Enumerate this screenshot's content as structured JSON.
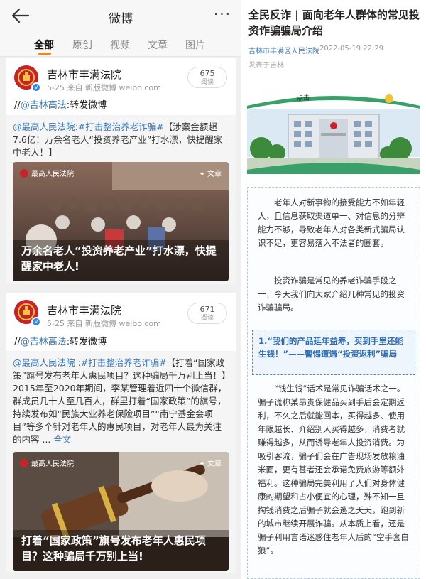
{
  "weibo": {
    "title": "微博",
    "more": "···",
    "tabs": [
      "全部",
      "原创",
      "视频",
      "文章",
      "图片"
    ],
    "posts": [
      {
        "author": "吉林市丰满法院",
        "meta": "5-25  来自 新版微博 weibo.com",
        "reads": "675",
        "reads_label": "阅读",
        "repost_prefix": "//",
        "repost_link": "@吉林高法",
        "repost_suffix": ":转发微博",
        "quote_author": "@最高人民法院",
        "quote_tag": ":#打击整治养老诈骗#",
        "quote_body": "【涉案金额超7.6亿！万余名老人“投资养老产业”打水漂，快提醒家中老人！】",
        "card_source": "最高人民法院",
        "card_tag": "文章",
        "card_caption": "万余名老人“投资养老产业”打水漂，快提醒家中老人!"
      },
      {
        "author": "吉林市丰满法院",
        "meta": "5-25  来自 新版微博 weibo.com",
        "reads": "671",
        "reads_label": "阅读",
        "repost_prefix": "//",
        "repost_link": "@吉林高法",
        "repost_suffix": ":转发微博",
        "quote_author": "@最高人民法院",
        "quote_tag": " :#打击整治养老诈骗#",
        "quote_body": "【打着“国家政策”旗号发布老年人惠民项目？这种骗局千万别上当！】2015年至2020年期间，李某管理着近四十个微信群，群成员几十人至几百人，群里打着“国家政策”的旗号，持续发布如“民族大业养老保险项目”“南宁基金会项目”等多个针对老年人的惠民项目，对老年人最为关注的内容 ... ",
        "quote_more": "全文",
        "card_source": "最高人民法院",
        "card_tag": "文章",
        "card_caption": "打着“国家政策”旗号发布老年人惠民项目？这种骗局千万别上当!"
      }
    ]
  },
  "article": {
    "title": "全民反诈 | 面向老年人群体的常见投资诈骗骗局介绍",
    "org": "吉林市丰满区人民法院",
    "date": "2022-05-19 22:29",
    "from": "发表于吉林",
    "banner_label": "点击",
    "p1": "老年人对新事物的接受能力不如年轻人，且信息获取渠道单一、对信息的分辨能力不够，导致老年人对各类新式骗局认识不足，更容易落入不法者的圈套。",
    "p2": "投资诈骗是常见的养老诈骗手段之一，今天我们向大家介绍几种常见的投资诈骗骗局。",
    "highlight": "1.“我们的产品延年益寿，买到手里还能生钱！”——警惕遭遇“投资返利”骗局",
    "p3": "“钱生钱”话术是常见诈骗话术之一。骗子谎称某昂贵保健品买到手后会定期返利，不久之后就能回本，买得越多、使用年限越长、介绍别人买得越多，消费者就赚得越多，从而诱导老年人投资消费。为吸引客流，骗子们会在广告现场发放粮油米面，更有甚者还会承诺免费旅游等额外福利。这种骗局完美利用了人们对身体健康的期望和占小便宜的心理，殊不知一旦掏钱消费之后骗子就会逃之夭夭，跑到新的城市继续开展诈骗。从本质上看，还是骗子利用言语迷惑住老年人后的“空手套白狼”。"
  },
  "colors": {
    "accent": "#ff8200",
    "link": "#3a76b5",
    "court_red": "#c8222a"
  }
}
